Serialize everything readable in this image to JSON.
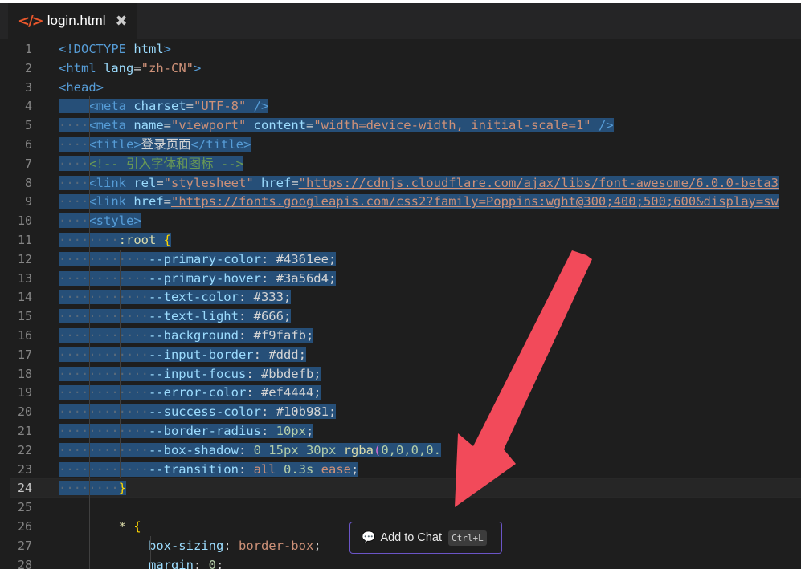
{
  "tab": {
    "icon": "</>",
    "filename": "login.html",
    "close": "✖"
  },
  "current_line": 24,
  "lines": [
    {
      "n": "1",
      "tokens": [
        [
          "t",
          "<!DOCTYPE "
        ],
        [
          "a",
          "html"
        ],
        [
          "t",
          ">"
        ]
      ]
    },
    {
      "n": "2",
      "tokens": [
        [
          "t",
          "<html "
        ],
        [
          "a",
          "lang"
        ],
        [
          "p",
          "="
        ],
        [
          "s",
          "\"zh-CN\""
        ],
        [
          "t",
          ">"
        ]
      ]
    },
    {
      "n": "3",
      "tokens": [
        [
          "t",
          "<head>"
        ]
      ]
    },
    {
      "n": "4",
      "tokens": [
        [
          "w",
          "    "
        ],
        [
          "t",
          "<meta "
        ],
        [
          "a",
          "charset"
        ],
        [
          "p",
          "="
        ],
        [
          "s",
          "\"UTF-8\""
        ],
        [
          "t",
          " />"
        ]
      ]
    },
    {
      "n": "5",
      "tokens": [
        [
          "w",
          "····"
        ],
        [
          "t",
          "<meta "
        ],
        [
          "a",
          "name"
        ],
        [
          "p",
          "="
        ],
        [
          "s",
          "\"viewport\""
        ],
        [
          "a",
          " content"
        ],
        [
          "p",
          "="
        ],
        [
          "s",
          "\"width=device-width, initial-scale=1\""
        ],
        [
          "t",
          " />"
        ]
      ]
    },
    {
      "n": "6",
      "tokens": [
        [
          "w",
          "····"
        ],
        [
          "t",
          "<title>"
        ],
        [
          "p",
          "登录页面"
        ],
        [
          "t",
          "</title>"
        ]
      ]
    },
    {
      "n": "7",
      "tokens": [
        [
          "w",
          "····"
        ],
        [
          "c",
          "<!-- 引入字体和图标 -->"
        ]
      ]
    },
    {
      "n": "8",
      "tokens": [
        [
          "w",
          "····"
        ],
        [
          "t",
          "<link "
        ],
        [
          "a",
          "rel"
        ],
        [
          "p",
          "="
        ],
        [
          "s",
          "\"stylesheet\""
        ],
        [
          "a",
          " href"
        ],
        [
          "p",
          "="
        ],
        [
          "su",
          "\"https://cdnjs.cloudflare.com/ajax/libs/font-awesome/6.0.0-beta3"
        ]
      ]
    },
    {
      "n": "9",
      "tokens": [
        [
          "w",
          "····"
        ],
        [
          "t",
          "<link "
        ],
        [
          "a",
          "href"
        ],
        [
          "p",
          "="
        ],
        [
          "su",
          "\"https://fonts.googleapis.com/css2?family=Poppins:wght@300;400;500;600&display=sw"
        ]
      ]
    },
    {
      "n": "10",
      "tokens": [
        [
          "w",
          "····"
        ],
        [
          "t",
          "<style>"
        ]
      ]
    },
    {
      "n": "11",
      "tokens": [
        [
          "w",
          "········"
        ],
        [
          "sel-s",
          ":root"
        ],
        [
          "p",
          " "
        ],
        [
          "br1",
          "{"
        ]
      ]
    },
    {
      "n": "12",
      "tokens": [
        [
          "w",
          "············"
        ],
        [
          "a",
          "--primary-color"
        ],
        [
          "p",
          ": #4361ee;"
        ]
      ]
    },
    {
      "n": "13",
      "tokens": [
        [
          "w",
          "············"
        ],
        [
          "a",
          "--primary-hover"
        ],
        [
          "p",
          ": #3a56d4;"
        ]
      ]
    },
    {
      "n": "14",
      "tokens": [
        [
          "w",
          "············"
        ],
        [
          "a",
          "--text-color"
        ],
        [
          "p",
          ": #333;"
        ]
      ]
    },
    {
      "n": "15",
      "tokens": [
        [
          "w",
          "············"
        ],
        [
          "a",
          "--text-light"
        ],
        [
          "p",
          ": #666;"
        ]
      ]
    },
    {
      "n": "16",
      "tokens": [
        [
          "w",
          "············"
        ],
        [
          "a",
          "--background"
        ],
        [
          "p",
          ": #f9fafb;"
        ]
      ]
    },
    {
      "n": "17",
      "tokens": [
        [
          "w",
          "············"
        ],
        [
          "a",
          "--input-border"
        ],
        [
          "p",
          ": #ddd;"
        ]
      ]
    },
    {
      "n": "18",
      "tokens": [
        [
          "w",
          "············"
        ],
        [
          "a",
          "--input-focus"
        ],
        [
          "p",
          ": #bbdefb;"
        ]
      ]
    },
    {
      "n": "19",
      "tokens": [
        [
          "w",
          "············"
        ],
        [
          "a",
          "--error-color"
        ],
        [
          "p",
          ": #ef4444;"
        ]
      ]
    },
    {
      "n": "20",
      "tokens": [
        [
          "w",
          "············"
        ],
        [
          "a",
          "--success-color"
        ],
        [
          "p",
          ": #10b981;"
        ]
      ]
    },
    {
      "n": "21",
      "tokens": [
        [
          "w",
          "············"
        ],
        [
          "a",
          "--border-radius"
        ],
        [
          "p",
          ": "
        ],
        [
          "num",
          "10px"
        ],
        [
          "p",
          ";"
        ]
      ]
    },
    {
      "n": "22",
      "tokens": [
        [
          "w",
          "············"
        ],
        [
          "a",
          "--box-shadow"
        ],
        [
          "p",
          ": "
        ],
        [
          "num",
          "0 15px 30px"
        ],
        [
          "p",
          " "
        ],
        [
          "fn",
          "rgba"
        ],
        [
          "br2",
          "("
        ],
        [
          "num",
          "0,0,0,0."
        ],
        [
          "p",
          ""
        ]
      ]
    },
    {
      "n": "23",
      "tokens": [
        [
          "w",
          "············"
        ],
        [
          "a",
          "--transition"
        ],
        [
          "p",
          ": "
        ],
        [
          "s",
          "all"
        ],
        [
          "p",
          " "
        ],
        [
          "num",
          "0.3s"
        ],
        [
          "p",
          " "
        ],
        [
          "s",
          "ease"
        ],
        [
          "p",
          ";"
        ]
      ]
    },
    {
      "n": "24",
      "tokens": [
        [
          "w",
          "········"
        ],
        [
          "br1",
          "}"
        ]
      ]
    },
    {
      "n": "25",
      "tokens": []
    },
    {
      "n": "26",
      "tokens": [
        [
          "p",
          "        "
        ],
        [
          "sel-s",
          "* "
        ],
        [
          "br1",
          "{"
        ]
      ]
    },
    {
      "n": "27",
      "tokens": [
        [
          "p",
          "            "
        ],
        [
          "a",
          "box-sizing"
        ],
        [
          "p",
          ": "
        ],
        [
          "s",
          "border-box"
        ],
        [
          "p",
          ";"
        ]
      ]
    },
    {
      "n": "28",
      "tokens": [
        [
          "p",
          "            "
        ],
        [
          "a",
          "margin"
        ],
        [
          "p",
          ": "
        ],
        [
          "num",
          "0"
        ],
        [
          "p",
          ";"
        ]
      ]
    }
  ],
  "selection_lines_count": 21,
  "add_to_chat": {
    "label": "Add to Chat",
    "shortcut": "Ctrl+L",
    "icon": "chat-bubble-icon"
  },
  "colors": {
    "selection": "#264f78",
    "arrow": "#f24a5a",
    "button_border": "#6b55c7"
  }
}
